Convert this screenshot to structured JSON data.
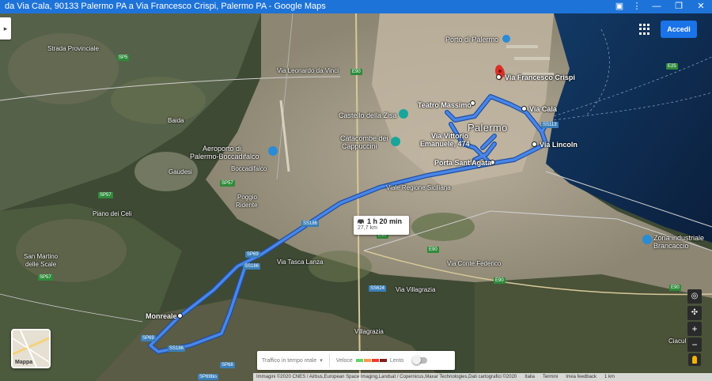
{
  "window": {
    "title": "da Via Cala, 90133 Palermo PA a Via Francesco Crispi, Palermo PA - Google Maps",
    "controls": [
      "▣",
      "⋮",
      "—",
      "❐",
      "✕"
    ]
  },
  "header": {
    "signin_label": "Accedi"
  },
  "route": {
    "duration": "1 h 20 min",
    "distance": "27,7 km"
  },
  "places": {
    "francesco_crispi": "Via Francesco Crispi",
    "via_cala": "Via Cala",
    "teatro_massimo": "Teatro Massimo",
    "palermo": "Palermo",
    "via_vittorio": "Via Vittorio",
    "emanuele_474": "Emanuele, 474",
    "via_lincoln": "Via Lincoln",
    "porta_sant_agata": "Porta Sant'Agata",
    "monreale": "Monreale",
    "porto": "Porto di Palermo",
    "castello_zisa": "Castello della Zisa",
    "catacombe_1": "Catacombe dei",
    "catacombe_2": "Cappuccini",
    "aeroporto_1": "Aeroporto di",
    "aeroporto_2": "Palermo-Boccadifalco",
    "boccadifalco": "Boccadifalco",
    "baida": "Baida",
    "gaudesi": "Gaudesi",
    "poggio_1": "Poggio",
    "poggio_2": "Ridente",
    "piano_celi": "Piano dei Celi",
    "san_martino_1": "San Martino",
    "san_martino_2": "delle Scale",
    "villagrazia": "Villagrazia",
    "zona_ind_1": "Zona industriale",
    "zona_ind_2": "Brancaccio",
    "ciaculli": "Ciacul",
    "strada_provinciale": "Strada Provinciale",
    "via_leonardo_vinci": "Via Leonardo da Vinci",
    "via_regione_siciliana": "Viale Regione Siciliana",
    "via_tasca_lanza": "Via Tasca Lanza",
    "via_villagrazia": "Via Villagrazia",
    "via_conte_federico": "Via Conte Federico"
  },
  "road_badges": {
    "sp5": "SP5",
    "sp57a": "SP57",
    "sp57b": "SP57",
    "sp57c": "SP57",
    "e90a": "E90",
    "e90b": "E90",
    "e90c": "E90",
    "e90d": "E90",
    "e90e": "E90",
    "ss186a": "SS186",
    "ss186b": "SS186",
    "ss186c": "SS186",
    "sp69": "SP69",
    "sp69b": "SP69bis",
    "sp68": "SP68",
    "ss624": "SS624",
    "ss113": "SS113",
    "e25": "E25"
  },
  "layers": {
    "label": "Mappa"
  },
  "traffic": {
    "label": "Traffico in tempo reale",
    "fast": "Veloce",
    "slow": "Lento"
  },
  "footer": {
    "imagery": "Immagini ©2020 CNES / Airbus,European Space Imaging,Landsat / Copernicus,Maxar Technologies,Dati cartografici ©2020",
    "country": "Italia",
    "terms": "Termini",
    "feedback": "Invia feedback",
    "scale": "1 km"
  },
  "colors": {
    "route": "#4a86e8",
    "route_outline": "#1f4fa0",
    "titlebar": "#1e73d8",
    "sea": "#0d2748",
    "pin": "#d93025",
    "signin": "#1a73e8"
  },
  "icons": {
    "car": "car-icon",
    "pin": "destination-pin-icon",
    "apps": "apps-grid-icon",
    "compass": "compass-icon",
    "zoom_in": "zoom-in-icon",
    "zoom_out": "zoom-out-icon",
    "pegman": "pegman-icon",
    "dropdown": "chevron-down-icon"
  }
}
